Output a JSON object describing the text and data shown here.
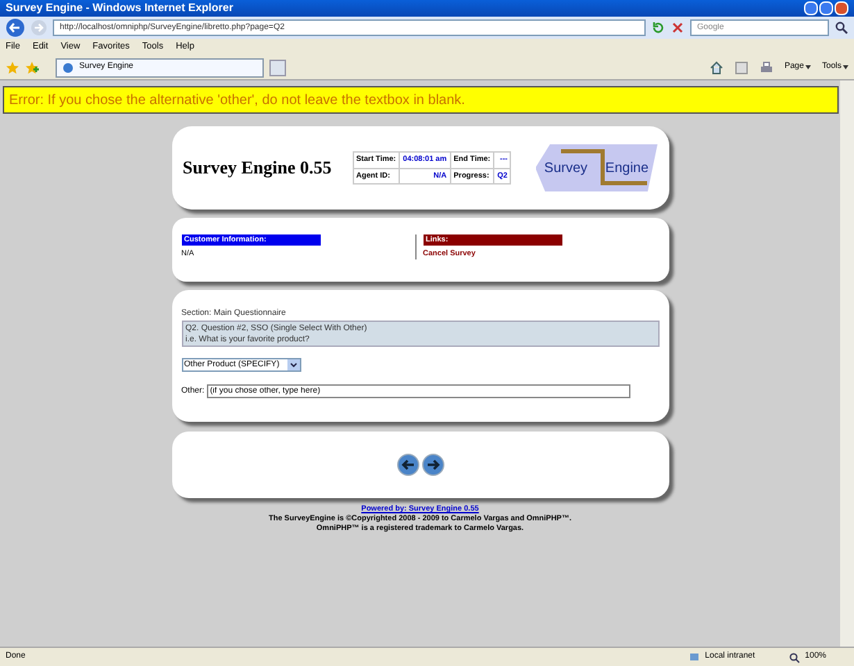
{
  "window": {
    "title": "Survey Engine - Windows Internet Explorer"
  },
  "address_bar": {
    "url": "http://localhost/omniphp/SurveyEngine/libretto.php?page=Q2",
    "search_placeholder": "Google"
  },
  "menu": [
    "File",
    "Edit",
    "View",
    "Favorites",
    "Tools",
    "Help"
  ],
  "tabs": [
    {
      "label": "Survey Engine",
      "selected": true
    }
  ],
  "command_bar": [
    "Page",
    "Tools"
  ],
  "error": "Error: If you chose the alternative 'other', do not leave the textbox in blank.",
  "header": {
    "title": "Survey Engine 0.55",
    "info": [
      {
        "label": "Start Time:",
        "value": "04:08:01 am"
      },
      {
        "label": "End Time:",
        "value": "---"
      },
      {
        "label": "Agent ID:",
        "value": "N/A"
      },
      {
        "label": "Progress:",
        "value": "Q2"
      }
    ],
    "logo": [
      "Survey",
      "Engine"
    ]
  },
  "customer": {
    "heading": "Customer Information:",
    "value": "N/A"
  },
  "links": {
    "heading": "Links:",
    "items": [
      "Cancel Survey"
    ]
  },
  "question": {
    "section": "Section: Main Questionnaire",
    "lines": [
      "Q2. Question #2, SSO (Single Select With Other)",
      "i.e. What is your favorite product?"
    ],
    "select_value": "Other Product (SPECIFY)",
    "other_label": "Other:",
    "other_value": "(if you chose other, type here)"
  },
  "footer": {
    "link": "Powered by: Survey Engine 0.55",
    "lines": [
      "The SurveyEngine is ©Copyrighted 2008 - 2009 to Carmelo Vargas and OmniPHP™.",
      "OmniPHP™ is a registered trademark to Carmelo Vargas."
    ]
  },
  "status_bar": {
    "text": "Done",
    "zone": "Local intranet",
    "zoom": "100%"
  }
}
